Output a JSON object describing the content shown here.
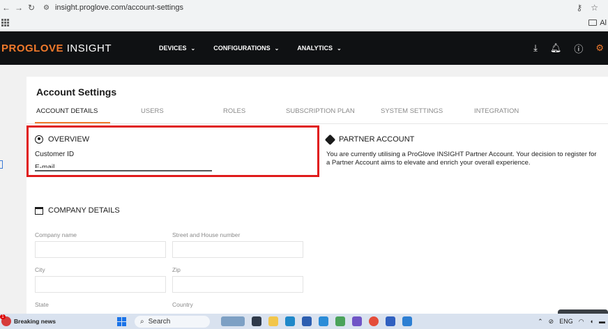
{
  "browser": {
    "url": "insight.proglove.com/account-settings",
    "bookmarks_right": "Al"
  },
  "topnav": {
    "brand_part1": "PROGLOVE",
    "brand_part2": "INSIGHT",
    "menu": [
      {
        "label": "DEVICES"
      },
      {
        "label": "CONFIGURATIONS"
      },
      {
        "label": "ANALYTICS"
      }
    ],
    "accent": "#f0792b"
  },
  "page": {
    "title": "Account Settings",
    "tabs": [
      {
        "label": "ACCOUNT DETAILS",
        "active": true
      },
      {
        "label": "USERS"
      },
      {
        "label": "ROLES"
      },
      {
        "label": "SUBSCRIPTION PLAN"
      },
      {
        "label": "SYSTEM SETTINGS"
      },
      {
        "label": "INTEGRATION"
      }
    ]
  },
  "overview": {
    "heading": "OVERVIEW",
    "customer_id_label": "Customer ID",
    "email_label": "E-mail"
  },
  "partner": {
    "heading": "PARTNER ACCOUNT",
    "text": "You are currently utilising a ProGlove INSIGHT Partner Account. Your decision to register for a Partner Account aims to elevate and enrich your overall experience."
  },
  "company": {
    "heading": "COMPANY DETAILS",
    "fields": [
      {
        "label": "Company name",
        "value": ""
      },
      {
        "label": "Street and House number",
        "value": ""
      },
      {
        "label": "City",
        "value": ""
      },
      {
        "label": "Zip",
        "value": ""
      },
      {
        "label": "State",
        "value": ""
      },
      {
        "label": "Country",
        "value": ""
      }
    ]
  },
  "taskbar": {
    "news_title": "Breaking news",
    "news_badge": "1",
    "search_label": "Search",
    "lang": "ENG"
  }
}
